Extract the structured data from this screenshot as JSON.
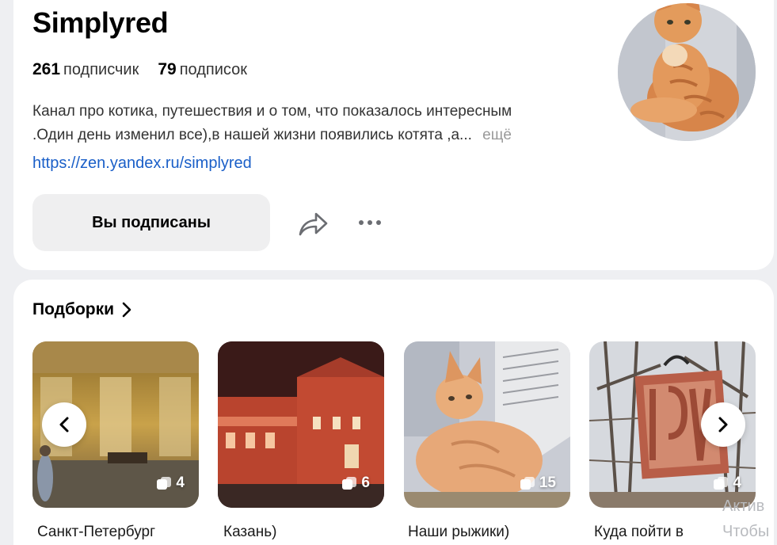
{
  "profile": {
    "title": "Simplyred",
    "stats": [
      {
        "num": "261",
        "label": "подписчик"
      },
      {
        "num": "79",
        "label": "подписок"
      }
    ],
    "description_line1": "Канал про котика, путешествия и о том, что показалось интересным",
    "description_line2": ".Один день изменил все),в нашей жизни появились котята ,а...",
    "more_label": "ещё",
    "url": "https://zen.yandex.ru/simplyred",
    "subscribe_label": "Вы подписаны",
    "share_icon": "share-icon",
    "more_icon": "more-dots-icon"
  },
  "collections": {
    "title": "Подборки",
    "items": [
      {
        "caption": "Санкт-Петербург",
        "count": "4"
      },
      {
        "caption": "Казань)",
        "count": "6"
      },
      {
        "caption": "Наши рыжики)",
        "count": "15"
      },
      {
        "caption": "Куда пойти в",
        "count": "4"
      }
    ]
  },
  "watermark": {
    "line1": "Актив",
    "line2": "Чтобы"
  },
  "colors": {
    "link": "#1a5fc8",
    "background": "#eeeff2",
    "button": "#efeff0"
  }
}
